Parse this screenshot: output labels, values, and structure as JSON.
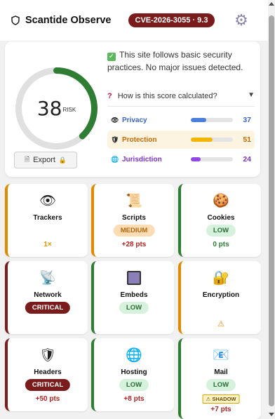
{
  "header": {
    "title": "Scantide Observe",
    "cve_badge": "CVE-2026-3055 · 9.3"
  },
  "summary": {
    "score": "38",
    "score_label": "RISK",
    "score_fraction": 0.38,
    "verdict": "This site follows basic security practices. No major issues detected.",
    "faq": "How is this score calculated?",
    "export_label": "Export"
  },
  "metrics": [
    {
      "label": "Privacy",
      "value": "37",
      "fraction": 0.37,
      "label_color": "#3a63c9",
      "fill": "#4a7fe0",
      "icon": "eye-icon"
    },
    {
      "label": "Protection",
      "value": "51",
      "fraction": 0.51,
      "label_color": "#c86a00",
      "fill": "#f2b600",
      "icon": "shield-icon"
    },
    {
      "label": "Jurisdiction",
      "value": "24",
      "fraction": 0.24,
      "label_color": "#7a32c8",
      "fill": "#9146e6",
      "icon": "globe-icon"
    }
  ],
  "tiles": [
    {
      "name": "Trackers",
      "icon": "eye-icon",
      "extra": "1×"
    },
    {
      "name": "Scripts",
      "icon": "scroll-icon",
      "badge": "MEDIUM",
      "pts": "+28 pts"
    },
    {
      "name": "Cookies",
      "icon": "cookie-icon",
      "badge": "LOW",
      "pts": "0 pts"
    },
    {
      "name": "Network",
      "icon": "satellite-icon",
      "badge": "CRITICAL"
    },
    {
      "name": "Embeds",
      "icon": "frame-icon",
      "badge": "LOW"
    },
    {
      "name": "Encryption",
      "icon": "lock-icon",
      "extra": "⚠"
    },
    {
      "name": "Headers",
      "icon": "shield-icon",
      "badge": "CRITICAL",
      "pts": "+50 pts"
    },
    {
      "name": "Hosting",
      "icon": "globe-icon",
      "badge": "LOW",
      "pts": "+8 pts"
    },
    {
      "name": "Mail",
      "icon": "mail-icon",
      "badge": "LOW",
      "tag": "⚠ SHADOW",
      "pts": "+7 pts"
    }
  ],
  "colors": {
    "critical": "#7a1c1c",
    "medium": "#e08a00",
    "low": "#2e7d32",
    "gauge_track": "#e0e0e0",
    "gauge_fill": "#2e7d32"
  }
}
